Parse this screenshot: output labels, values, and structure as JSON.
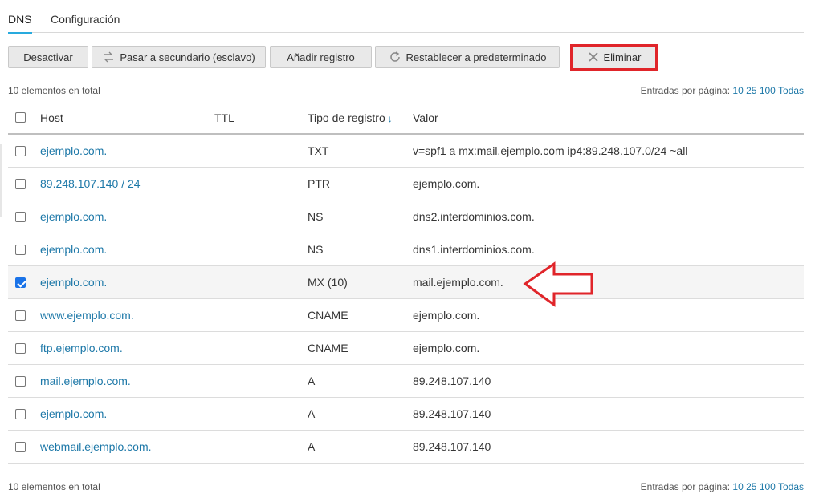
{
  "tabs": [
    {
      "label": "DNS",
      "active": true
    },
    {
      "label": "Configuración",
      "active": false
    }
  ],
  "toolbar": {
    "deactivate_label": "Desactivar",
    "secondary_label": "Pasar a secundario (esclavo)",
    "add_label": "Añadir registro",
    "reset_label": "Restablecer a predeterminado",
    "delete_label": "Eliminar"
  },
  "summary": {
    "total_text": "10 elementos en total",
    "per_page_label": "Entradas por página:",
    "per_page_options": [
      "10",
      "25",
      "100",
      "Todas"
    ]
  },
  "columns": {
    "host": "Host",
    "ttl": "TTL",
    "type": "Tipo de registro",
    "type_sort_indicator": "↓",
    "value": "Valor"
  },
  "records": [
    {
      "host": "ejemplo.com.",
      "ttl": "",
      "type": "TXT",
      "value": "v=spf1 a mx:mail.ejemplo.com ip4:89.248.107.0/24 ~all",
      "checked": false
    },
    {
      "host": "89.248.107.140 / 24",
      "ttl": "",
      "type": "PTR",
      "value": "ejemplo.com.",
      "checked": false
    },
    {
      "host": "ejemplo.com.",
      "ttl": "",
      "type": "NS",
      "value": "dns2.interdominios.com.",
      "checked": false
    },
    {
      "host": "ejemplo.com.",
      "ttl": "",
      "type": "NS",
      "value": "dns1.interdominios.com.",
      "checked": false
    },
    {
      "host": "ejemplo.com.",
      "ttl": "",
      "type": "MX (10)",
      "value": "mail.ejemplo.com.",
      "checked": true
    },
    {
      "host": "www.ejemplo.com.",
      "ttl": "",
      "type": "CNAME",
      "value": "ejemplo.com.",
      "checked": false
    },
    {
      "host": "ftp.ejemplo.com.",
      "ttl": "",
      "type": "CNAME",
      "value": "ejemplo.com.",
      "checked": false
    },
    {
      "host": "mail.ejemplo.com.",
      "ttl": "",
      "type": "A",
      "value": "89.248.107.140",
      "checked": false
    },
    {
      "host": "ejemplo.com.",
      "ttl": "",
      "type": "A",
      "value": "89.248.107.140",
      "checked": false
    },
    {
      "host": "webmail.ejemplo.com.",
      "ttl": "",
      "type": "A",
      "value": "89.248.107.140",
      "checked": false
    }
  ],
  "colors": {
    "accent": "#28aade",
    "link": "#1d78a8",
    "highlight": "#e0252a",
    "checkbox_checked": "#1a73e8"
  },
  "icons": {
    "secondary": "switch-arrows-icon",
    "reset": "reset-circular-arrow-icon",
    "delete": "x-delete-icon"
  }
}
